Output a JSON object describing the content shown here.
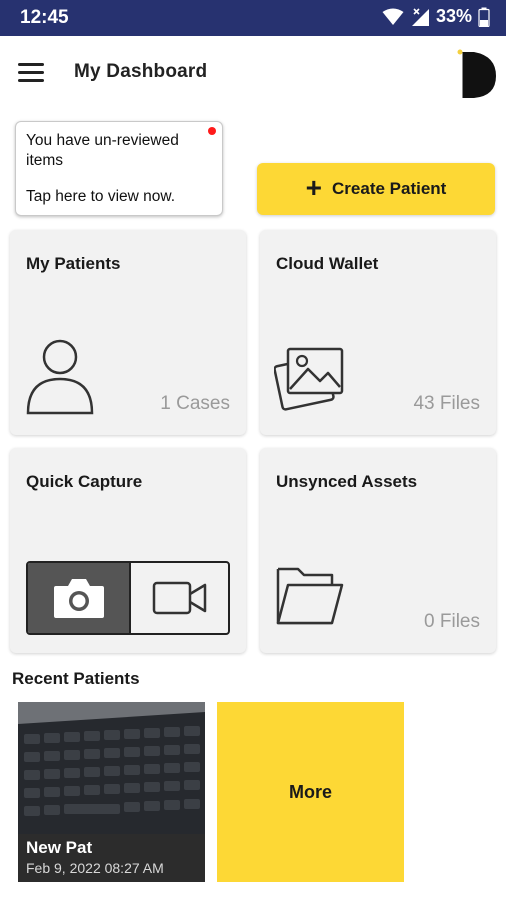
{
  "status_bar": {
    "time": "12:45",
    "battery_percent": "33%"
  },
  "header": {
    "title": "My Dashboard"
  },
  "notice": {
    "line1": "You have un-reviewed items",
    "line2": "Tap here to view now."
  },
  "actions": {
    "create_patient": "Create Patient"
  },
  "cards": {
    "my_patients": {
      "title": "My Patients",
      "count": "1 Cases"
    },
    "cloud_wallet": {
      "title": "Cloud Wallet",
      "count": "43 Files"
    },
    "quick_capture": {
      "title": "Quick Capture"
    },
    "unsynced_assets": {
      "title": "Unsynced Assets",
      "count": "0 Files"
    }
  },
  "recent_patients": {
    "heading": "Recent Patients",
    "items": [
      {
        "name": "New Pat",
        "date": "Feb 9, 2022 08:27 AM"
      }
    ],
    "more_label": "More"
  },
  "colors": {
    "status_bar": "#273270",
    "accent": "#fdd835",
    "card_bg": "#f2f2f2",
    "notification_dot": "#ff1a1a"
  }
}
